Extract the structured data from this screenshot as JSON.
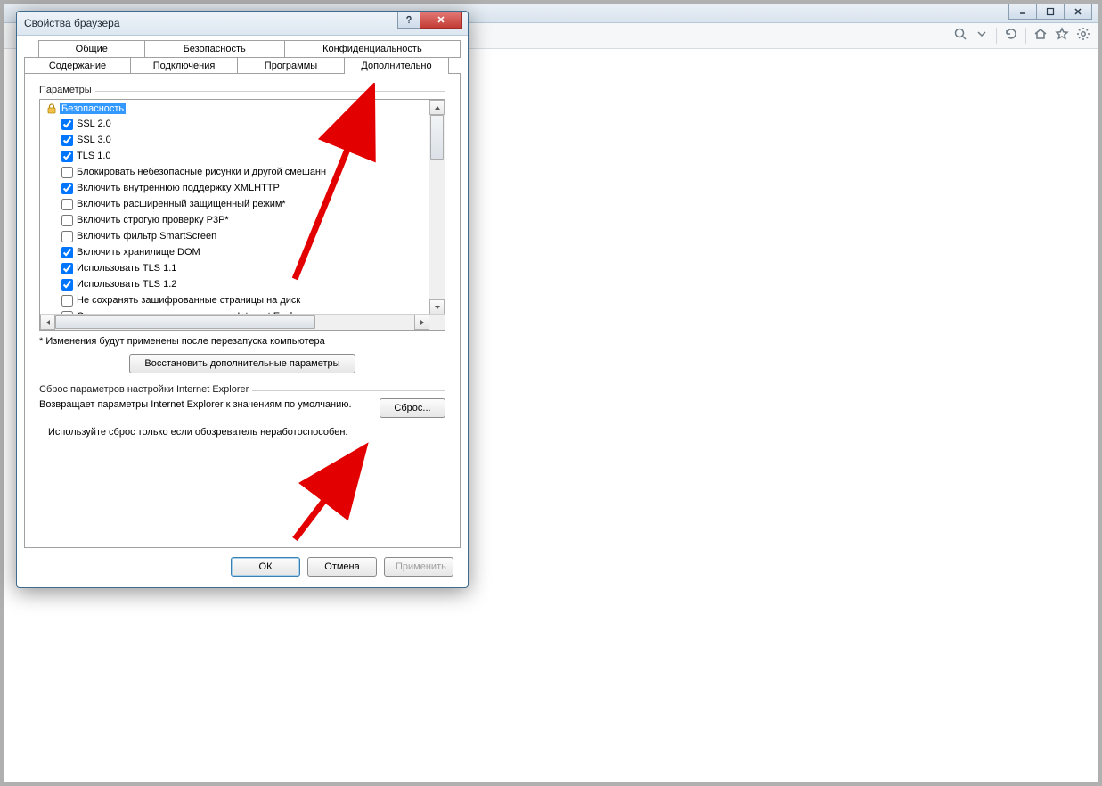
{
  "dialog": {
    "title": "Свойства браузера",
    "tabs_row1": [
      "Общие",
      "Безопасность",
      "Конфиденциальность"
    ],
    "tabs_row2": [
      "Содержание",
      "Подключения",
      "Программы",
      "Дополнительно"
    ],
    "group_settings": "Параметры",
    "category": "Безопасность",
    "items": [
      {
        "label": "SSL 2.0",
        "checked": true
      },
      {
        "label": "SSL 3.0",
        "checked": true
      },
      {
        "label": "TLS 1.0",
        "checked": true
      },
      {
        "label": "Блокировать небезопасные рисунки и другой смешанн",
        "checked": false
      },
      {
        "label": "Включить внутреннюю поддержку XMLHTTP",
        "checked": true
      },
      {
        "label": "Включить расширенный защищенный режим*",
        "checked": false
      },
      {
        "label": "Включить строгую проверку P3P*",
        "checked": false
      },
      {
        "label": "Включить фильтр SmartScreen",
        "checked": false
      },
      {
        "label": "Включить хранилище DOM",
        "checked": true
      },
      {
        "label": "Использовать TLS 1.1",
        "checked": true
      },
      {
        "label": "Использовать TLS 1.2",
        "checked": true
      },
      {
        "label": "Не сохранять зашифрованные страницы на диск",
        "checked": false
      },
      {
        "label": "Отправлять на посещаемые через Internet Explorer ве",
        "checked": false
      }
    ],
    "note": "* Изменения будут применены после перезапуска компьютера",
    "restore_btn": "Восстановить дополнительные параметры",
    "group_reset": "Сброс параметров настройки Internet Explorer",
    "reset_text": "Возвращает параметры Internet Explorer к значениям по умолчанию.",
    "reset_btn": "Сброс...",
    "reset_hint": "Используйте сброс только если обозреватель неработоспособен.",
    "ok": "ОК",
    "cancel": "Отмена",
    "apply": "Применить"
  }
}
